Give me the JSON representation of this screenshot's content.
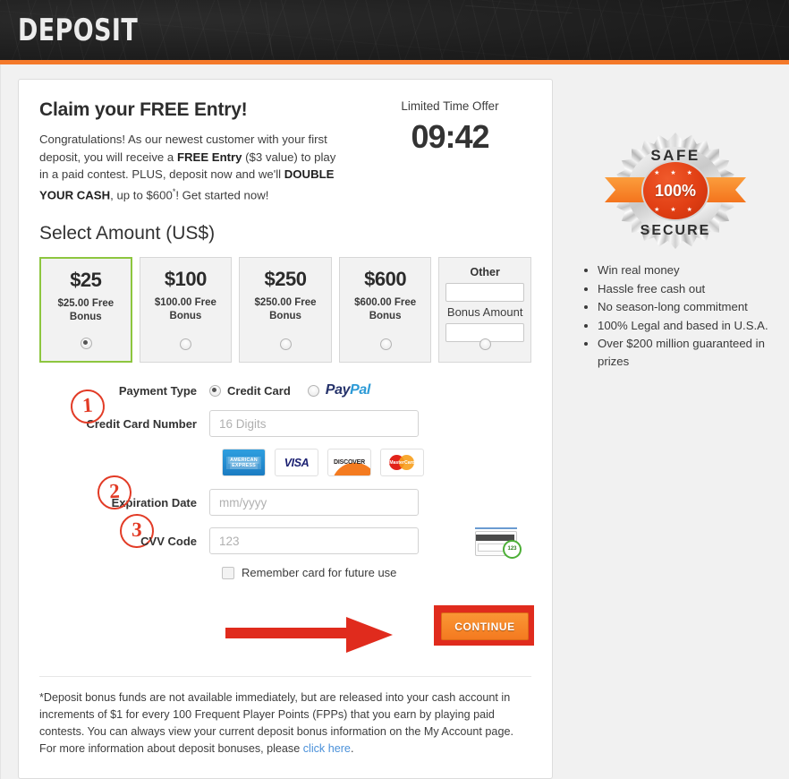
{
  "header": {
    "title": "DEPOSIT",
    "accent_color": "#f4792a",
    "background_color": "#1d1d1d"
  },
  "promo": {
    "heading": "Claim your FREE Entry!",
    "body_1": "Congratulations! As our newest customer with your first deposit, you will receive a ",
    "body_bold_1": "FREE Entry",
    "body_2": " ($3 value) to play in a paid contest. PLUS, deposit now and we'll ",
    "body_bold_2": "DOUBLE YOUR CASH",
    "body_3": ", up to $600",
    "body_asterisk": "*",
    "body_4": "! Get started now!"
  },
  "timer": {
    "label": "Limited Time Offer",
    "value": "09:42"
  },
  "select_amount": {
    "heading": "Select Amount (US$)",
    "selected_index": 0,
    "selected_border_color": "#8dc63f",
    "tiles": [
      {
        "amount": "$25",
        "bonus": "$25.00 Free Bonus",
        "selected": true
      },
      {
        "amount": "$100",
        "bonus": "$100.00 Free Bonus",
        "selected": false
      },
      {
        "amount": "$250",
        "bonus": "$250.00 Free Bonus",
        "selected": false
      },
      {
        "amount": "$600",
        "bonus": "$600.00 Free Bonus",
        "selected": false
      }
    ],
    "other": {
      "label": "Other",
      "amount_value": "",
      "bonus_label": "Bonus Amount",
      "bonus_value": "",
      "selected": false
    }
  },
  "payment": {
    "type_label": "Payment Type",
    "credit_card_label": "Credit Card",
    "credit_card_selected": true,
    "paypal_label_1": "Pay",
    "paypal_label_2": "Pal",
    "paypal_selected": false,
    "fields": {
      "card_number_label": "Credit Card Number",
      "card_number_placeholder": "16 Digits",
      "card_number_value": "",
      "expiration_label": "Expiration Date",
      "expiration_placeholder": "mm/yyyy",
      "expiration_value": "",
      "cvv_label": "CVV Code",
      "cvv_placeholder": "123",
      "cvv_value": "",
      "cvv_hint_digits": "123"
    },
    "accepted_cards": [
      {
        "name": "american-express",
        "line1": "AMERICAN",
        "line2": "EXPRESS"
      },
      {
        "name": "visa",
        "text": "VISA"
      },
      {
        "name": "discover",
        "text": "DISCOVER"
      },
      {
        "name": "mastercard",
        "text": "MasterCard"
      }
    ],
    "remember_card_label": "Remember card for future use",
    "remember_card_checked": false,
    "annotations": {
      "one": "1",
      "two": "2",
      "three": "3",
      "color": "#e23b26"
    }
  },
  "continue_button": {
    "label": "CONTINUE",
    "color": "#f47a20",
    "highlight_color": "#e02b1d"
  },
  "footnote": {
    "text": "*Deposit bonus funds are not available immediately, but are released into your cash account in increments of $1 for every 100 Frequent Player Points (FPPs) that you earn by playing paid contests. You can always view your current deposit bonus information on the My Account page. For more information about deposit bonuses, please ",
    "link_text": "click here",
    "text_end": "."
  },
  "sidebar": {
    "badge": {
      "top_word": "SAFE",
      "bottom_word": "SECURE",
      "percent": "100%",
      "stars": "★ ★ ★"
    },
    "benefits": [
      "Win real money",
      "Hassle free cash out",
      "No season-long commitment",
      "100% Legal and based in U.S.A.",
      "Over $200 million guaranteed in prizes"
    ]
  }
}
